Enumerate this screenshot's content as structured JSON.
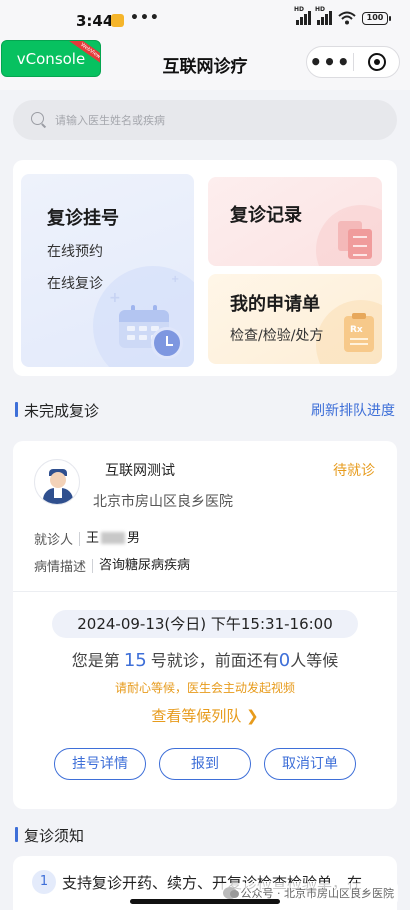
{
  "status_bar": {
    "time": "3:44",
    "dots": "•••",
    "battery": "100"
  },
  "nav": {
    "title": "互联网诊疗",
    "more": "•••"
  },
  "vconsole": {
    "label": "vConsole",
    "ribbon": "WebView"
  },
  "search": {
    "placeholder": "请输入医生姓名或疾病"
  },
  "services": {
    "followup": {
      "title": "复诊挂号",
      "line1": "在线预约",
      "line2": "在线复诊"
    },
    "records": {
      "title": "复诊记录"
    },
    "applications": {
      "title": "我的申请单",
      "line1": "检查/检验/处方",
      "rx": "Rx"
    }
  },
  "pending": {
    "heading": "未完成复诊",
    "refresh": "刷新排队进度"
  },
  "visit": {
    "doctor": "互联网测试",
    "status": "待就诊",
    "hospital": "北京市房山区良乡医院",
    "patient_label": "就诊人",
    "patient_surname": "王",
    "patient_gender": "男",
    "desc_label": "病情描述",
    "desc_value": "咨询糖尿病疾病",
    "datetime": "2024-09-13(今日) 下午15:31-16:00",
    "queue_prefix": "您是第",
    "queue_number": "15",
    "queue_mid": "号就诊，前面还有",
    "queue_ahead": "0",
    "queue_suffix": "人等候",
    "wait_note": "请耐心等候，医生会主动发起视频",
    "view_queue": "查看等候列队 ❯",
    "buttons": {
      "detail": "挂号详情",
      "checkin": "报到",
      "cancel": "取消订单"
    }
  },
  "notice": {
    "heading": "复诊须知",
    "item_number": "1",
    "item_text": "支持复诊开药、续方、开复诊检查检验单，在"
  },
  "watermark": {
    "text": "公众号 · 北京市房山区良乡医院"
  },
  "colors": {
    "accent": "#3e6fd8",
    "warning": "#e79b1c",
    "vconsole_green": "#07c160"
  }
}
